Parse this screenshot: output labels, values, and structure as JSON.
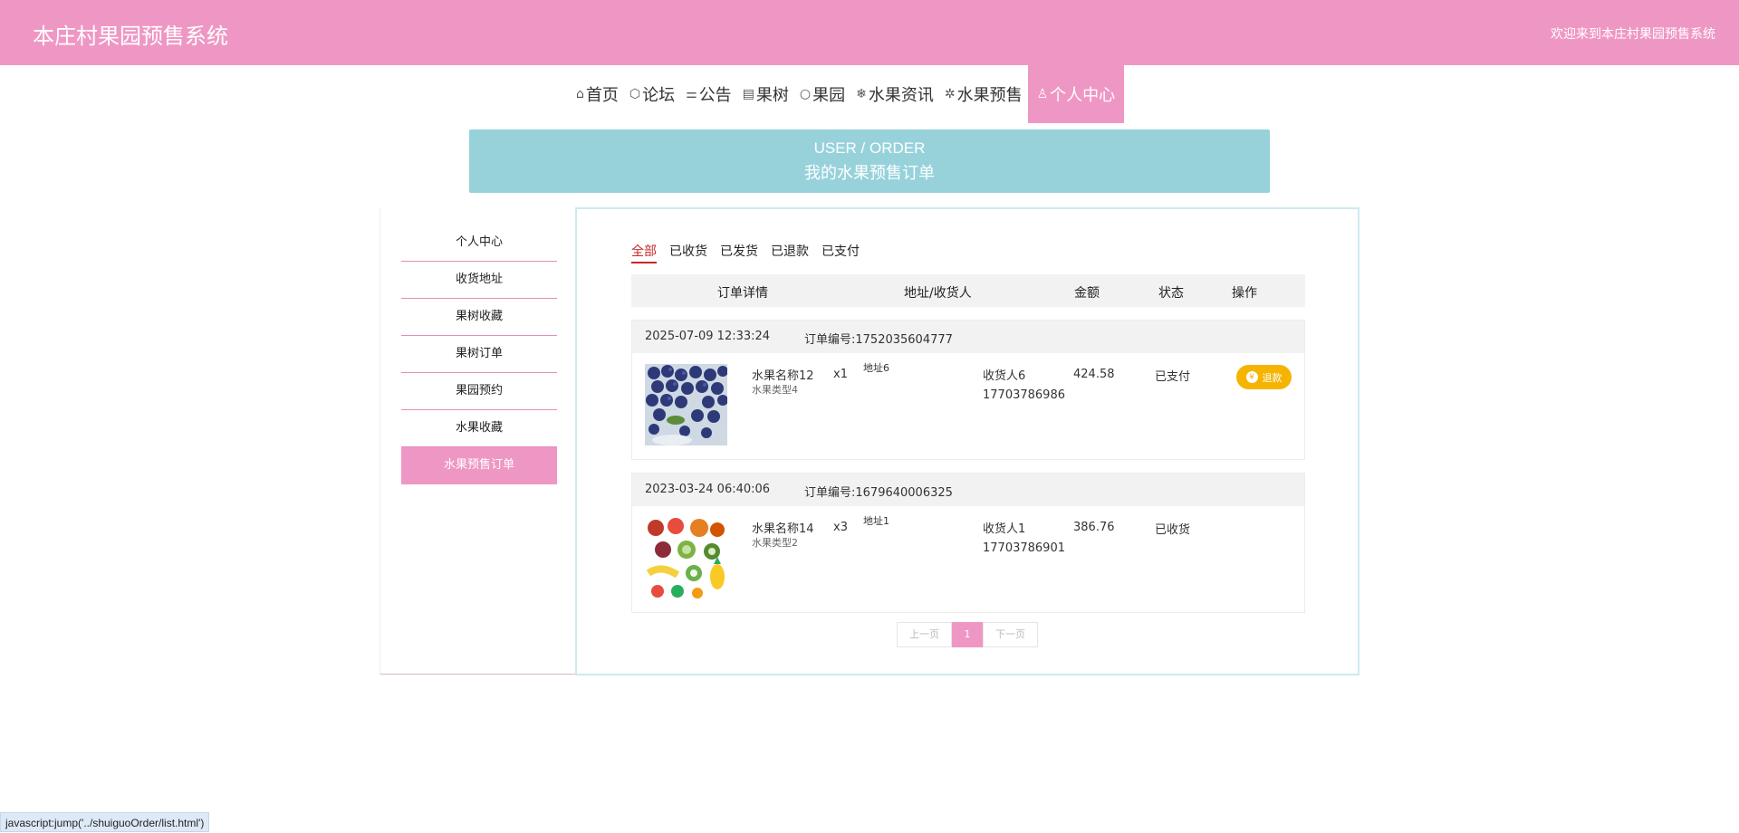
{
  "header": {
    "title": "本庄村果园预售系统",
    "welcome": "欢迎来到本庄村果园预售系统"
  },
  "nav": [
    {
      "icon": "home-icon",
      "glyph": "⌂",
      "label": "首页"
    },
    {
      "icon": "cube-icon",
      "glyph": "⬡",
      "label": "论坛"
    },
    {
      "icon": "sliders-icon",
      "glyph": "⚌",
      "label": "公告"
    },
    {
      "icon": "calendar-icon",
      "glyph": "▤",
      "label": "果树"
    },
    {
      "icon": "circle-icon",
      "glyph": "○",
      "label": "果园"
    },
    {
      "icon": "snowflake-icon",
      "glyph": "❄",
      "label": "水果资讯"
    },
    {
      "icon": "gear-icon",
      "glyph": "✲",
      "label": "水果预售"
    },
    {
      "icon": "user-icon",
      "glyph": "♙",
      "label": "个人中心",
      "active": true
    }
  ],
  "banner": {
    "en": "USER / ORDER",
    "cn": "我的水果预售订单"
  },
  "sidebar": [
    {
      "label": "个人中心"
    },
    {
      "label": "收货地址"
    },
    {
      "label": "果树收藏"
    },
    {
      "label": "果树订单"
    },
    {
      "label": "果园预约"
    },
    {
      "label": "水果收藏"
    },
    {
      "label": "水果预售订单",
      "active": true
    }
  ],
  "tabs": [
    {
      "label": "全部",
      "active": true
    },
    {
      "label": "已收货"
    },
    {
      "label": "已发货"
    },
    {
      "label": "已退款"
    },
    {
      "label": "已支付"
    }
  ],
  "table_header": {
    "detail": "订单详情",
    "address": "地址/收货人",
    "amount": "金额",
    "status": "状态",
    "action": "操作"
  },
  "orders": [
    {
      "time": "2025-07-09 12:33:24",
      "order_no": "订单编号:1752035604777",
      "name": "水果名称12",
      "type": "水果类型4",
      "qty": "x1",
      "address": "地址6",
      "receiver": "收货人6",
      "phone": "17703786986",
      "amount": "424.58",
      "status": "已支付",
      "action": "退款",
      "image": "blueberries"
    },
    {
      "time": "2023-03-24 06:40:06",
      "order_no": "订单编号:1679640006325",
      "name": "水果名称14",
      "type": "水果类型2",
      "qty": "x3",
      "address": "地址1",
      "receiver": "收货人1",
      "phone": "17703786901",
      "amount": "386.76",
      "status": "已收货",
      "image": "mixed-fruits"
    }
  ],
  "pager": {
    "prev": "上一页",
    "current": "1",
    "next": "下一页"
  },
  "statusbar": "javascript:jump('../shuiguoOrder/list.html')"
}
